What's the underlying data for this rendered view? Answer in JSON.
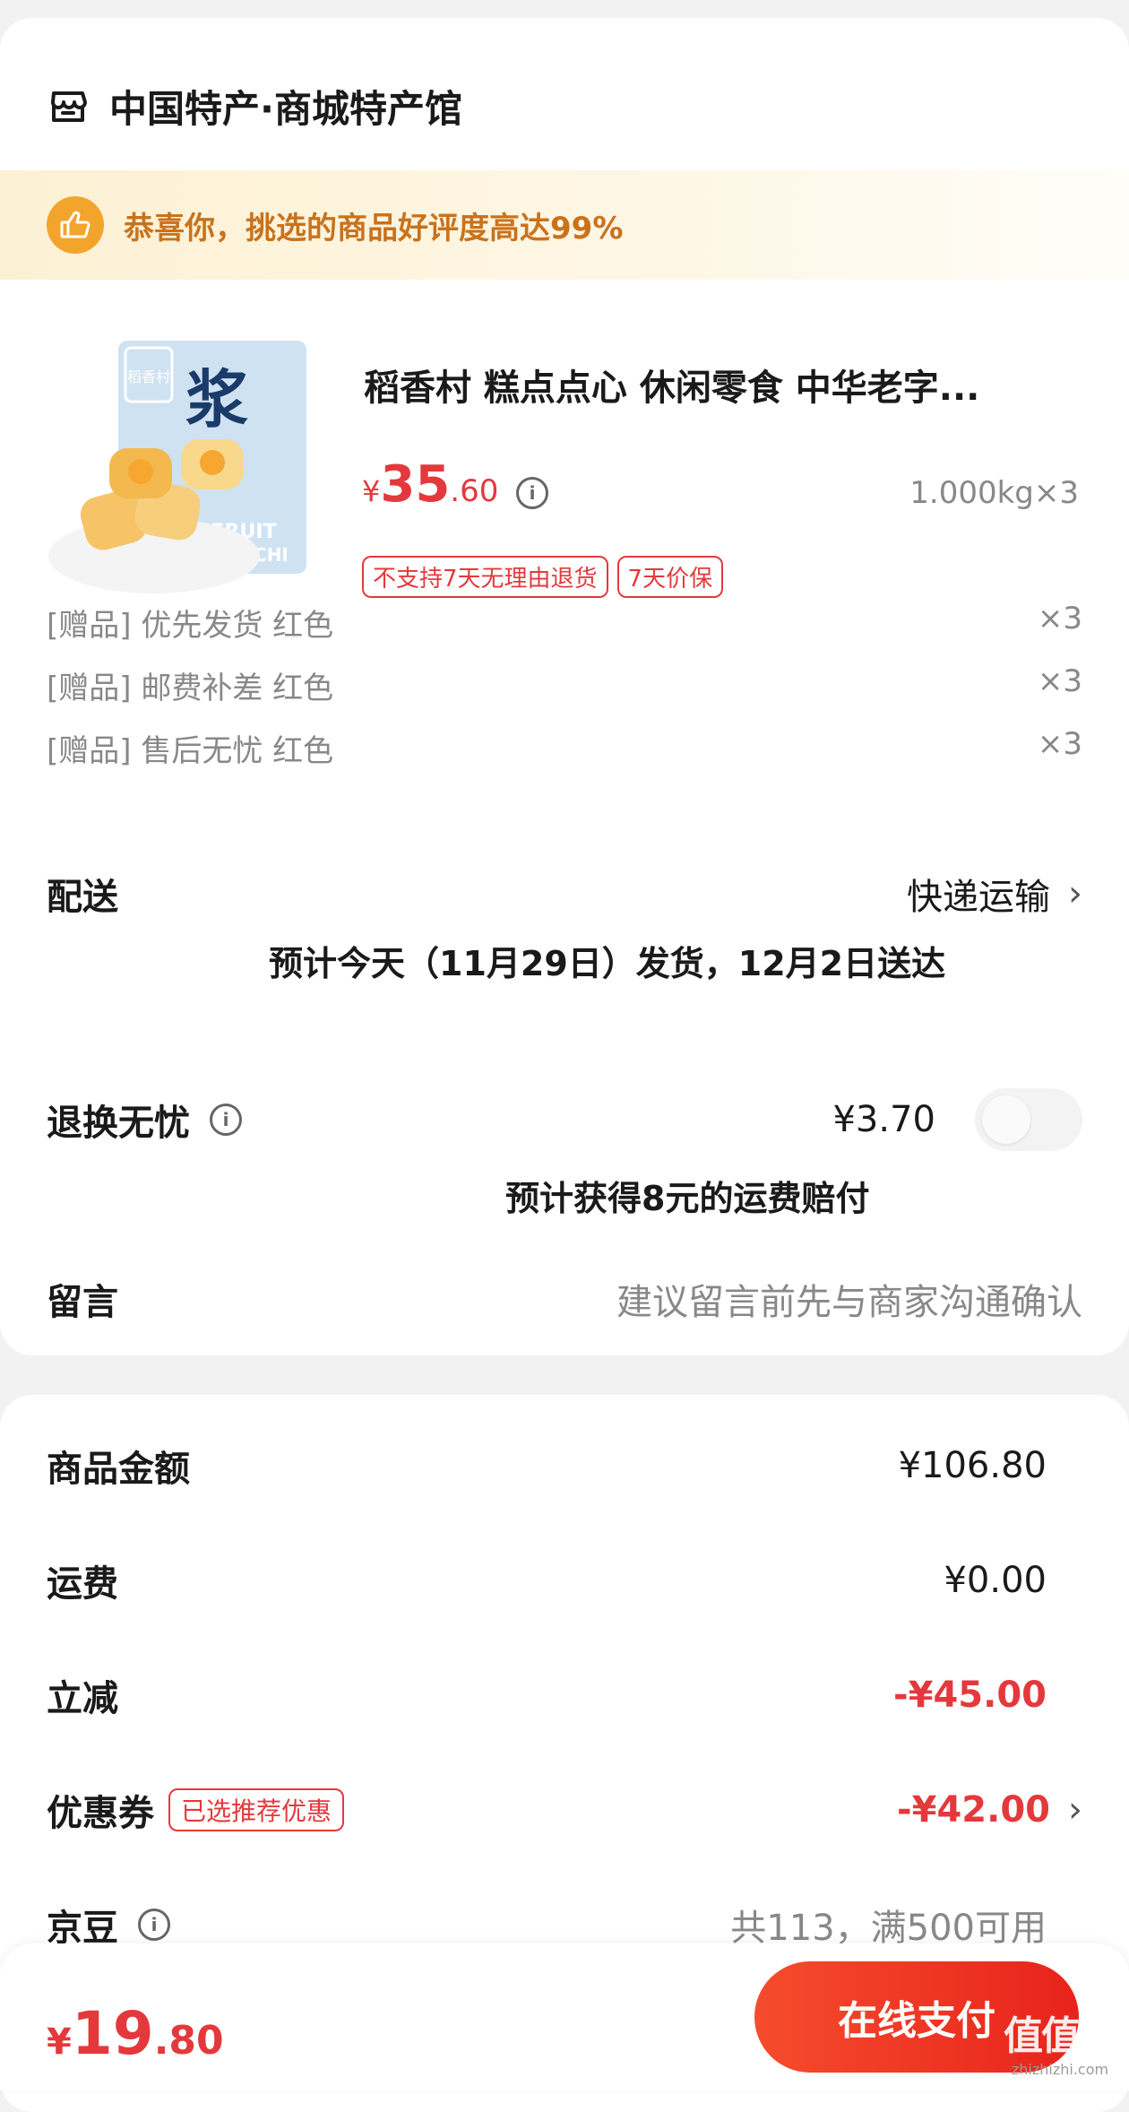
{
  "shop": {
    "name": "中国特产·商城特产馆"
  },
  "banner": {
    "text": "恭喜你，挑选的商品好评度高达99%"
  },
  "product": {
    "title": "稻香村 糕点点心 休闲零食 中华老字...",
    "price_currency": "¥",
    "price_int": "35",
    "price_dec": ".60",
    "spec": "1.000kg×3",
    "tags": [
      "不支持7天无理由退货",
      "7天价保"
    ],
    "image_text": {
      "package_brand": "稻香村",
      "package_big": "浆",
      "package_fruit": "FRUIT",
      "package_mochi": "MOCHI"
    }
  },
  "gifts": [
    {
      "label": "[赠品] 优先发货 红色",
      "qty": "×3"
    },
    {
      "label": "[赠品] 邮费补差 红色",
      "qty": "×3"
    },
    {
      "label": "[赠品] 售后无忧 红色",
      "qty": "×3"
    }
  ],
  "delivery": {
    "label": "配送",
    "method": "快递运输",
    "estimate": "预计今天（11月29日）发货，12月2日送达"
  },
  "return_service": {
    "label": "退换无忧",
    "price": "¥3.70",
    "note": "预计获得8元的运费赔付",
    "enabled": false
  },
  "message": {
    "label": "留言",
    "placeholder": "建议留言前先与商家沟通确认"
  },
  "summary": {
    "goods_label": "商品金额",
    "goods_value": "¥106.80",
    "shipping_label": "运费",
    "shipping_value": "¥0.00",
    "discount_label": "立减",
    "discount_value": "-¥45.00",
    "coupon_label": "优惠券",
    "coupon_tag": "已选推荐优惠",
    "coupon_value": "-¥42.00",
    "beans_label": "京豆",
    "beans_value": "共113，满500可用"
  },
  "bottom": {
    "total_cur": "¥",
    "total_int": "19",
    "total_dec": ".80",
    "pay_label": "在线支付",
    "watermark_big": "值值值",
    "watermark_small": "zhizhizhi.com"
  },
  "colors": {
    "accent_red": "#e4393c",
    "banner_orange": "#c9721c",
    "banner_bg": "#fdf1d4"
  }
}
